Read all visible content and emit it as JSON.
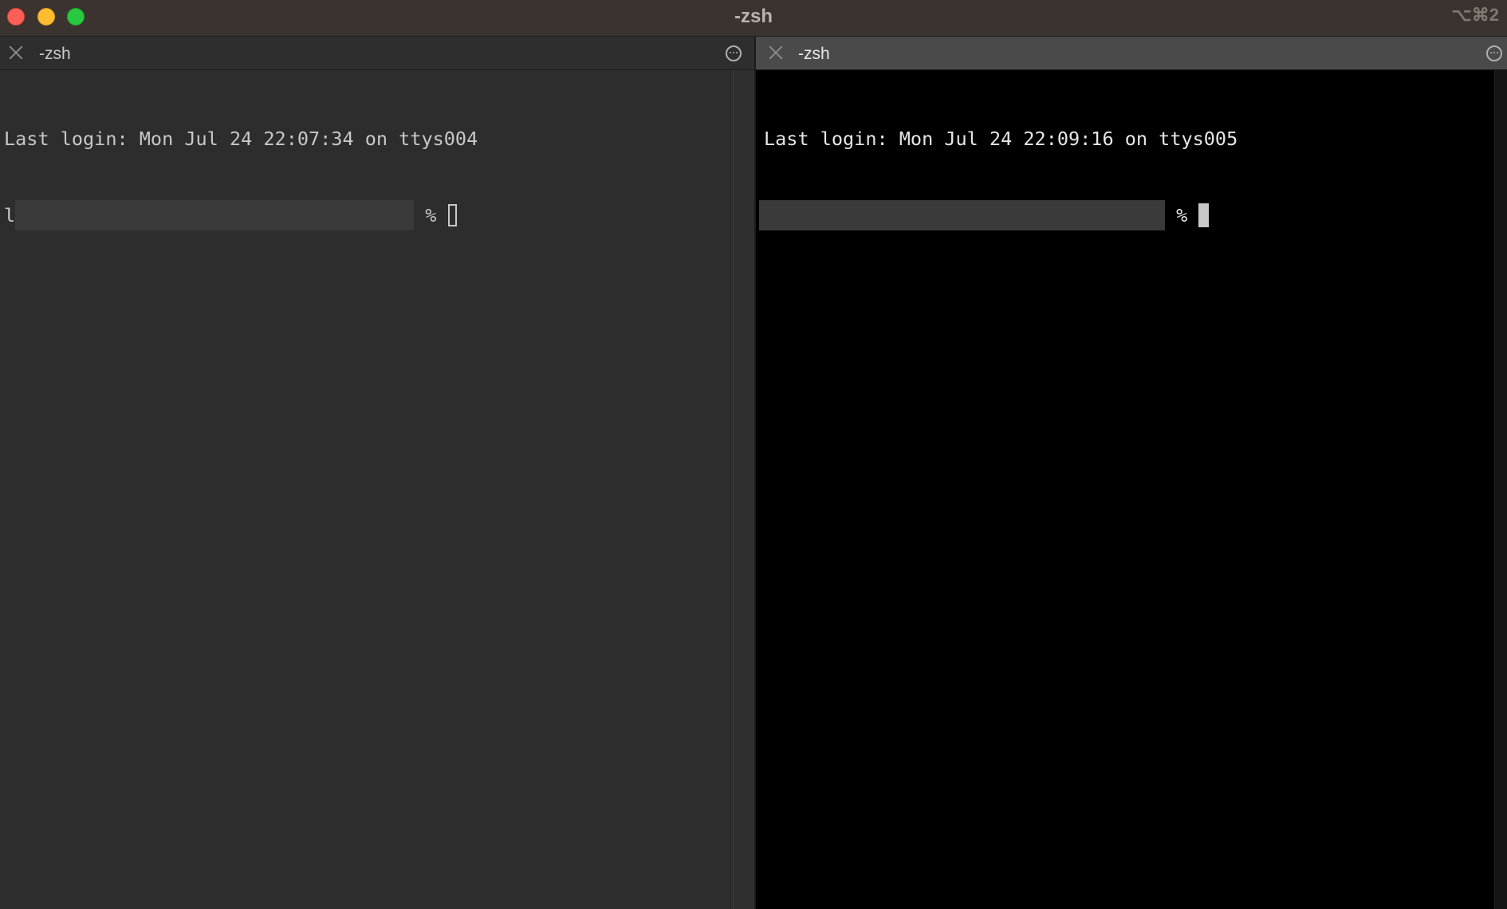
{
  "window": {
    "title": "-zsh",
    "shortcut": "⌥⌘2",
    "buttons": {
      "close": "#fe5f57",
      "minimize": "#febc2e",
      "zoom": "#28c840"
    }
  },
  "panes": [
    {
      "tab_title": "-zsh",
      "active": false,
      "background": "#2d2d2d",
      "lines": {
        "login": "Last login: Mon Jul 24 22:07:34 on ttys004",
        "prompt_prefix": "l",
        "prompt_symbol": " % "
      },
      "cursor": "hollow"
    },
    {
      "tab_title": "-zsh",
      "active": true,
      "background": "#000000",
      "lines": {
        "login": "Last login: Mon Jul 24 22:09:16 on ttys005",
        "prompt_prefix": "",
        "prompt_symbol": " % "
      },
      "cursor": "block"
    }
  ],
  "icons": {
    "tab_close": "close-icon",
    "tab_more": "ellipsis-circle-icon"
  }
}
